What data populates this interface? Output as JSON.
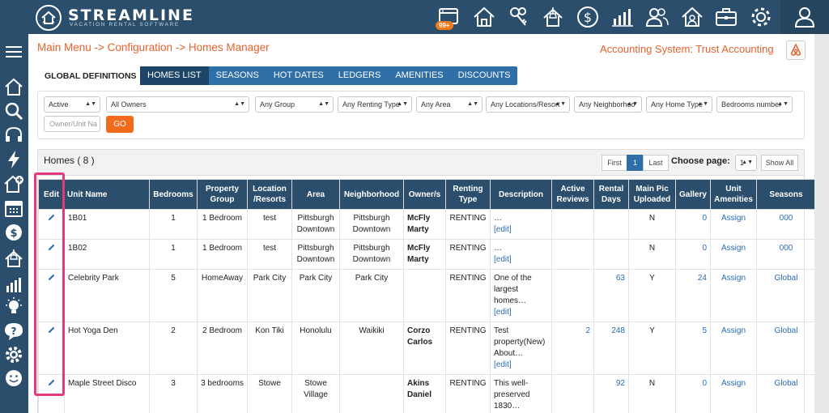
{
  "brand": {
    "name": "STREAMLINE",
    "tagline": "VACATION RENTAL SOFTWARE"
  },
  "topbar": {
    "icons": [
      "inbox-icon",
      "home-icon",
      "keys-icon",
      "housekeeping-icon",
      "dollar-icon",
      "bar-chart-icon",
      "owners-icon",
      "owner-home-icon",
      "toolbox-icon",
      "gear-icon",
      "user-icon"
    ],
    "notification_count": "99+"
  },
  "sidebar": {
    "icons": [
      "home-icon",
      "search-icon",
      "headset-icon",
      "lightning-icon",
      "add-home-icon",
      "calendar-icon",
      "dollar-icon",
      "housekeeping-icon",
      "bar-chart-icon",
      "lightbulb-icon",
      "help-icon",
      "gear-icon",
      "smiley-icon"
    ]
  },
  "breadcrumb": "Main Menu -> Configuration -> Homes Manager",
  "accounting": "Accounting System: Trust Accounting",
  "defs_label": "GLOBAL DEFINITIONS",
  "tabs": [
    {
      "label": "HOMES LIST",
      "active": true
    },
    {
      "label": "SEASONS"
    },
    {
      "label": "HOT DATES"
    },
    {
      "label": "LEDGERS"
    },
    {
      "label": "AMENITIES"
    },
    {
      "label": "DISCOUNTS"
    }
  ],
  "filters": {
    "selects": [
      "Active",
      "All Owners",
      "Any Group",
      "Any Renting Type",
      "Any Area",
      "Any Locations/Resort",
      "Any Neighborhoo",
      "Any Home Type",
      "Bedrooms number"
    ],
    "owner_unit_placeholder": "Owner/Unit Na",
    "go_label": "GO"
  },
  "homes": {
    "title": "Homes ( 8 )",
    "pager": {
      "first": "First",
      "page": "1",
      "last": "Last",
      "choose_label": "Choose page:",
      "choose_value": "1",
      "show_all": "Show All"
    },
    "columns": [
      "Edit",
      "Unit Name",
      "Bedrooms",
      "Property Group",
      "Location /Resorts",
      "Area",
      "Neighborhood",
      "Owner/s",
      "Renting Type",
      "Description",
      "Active Reviews",
      "Rental Days",
      "Main Pic Uploaded",
      "Gallery",
      "Unit Amenities",
      "Seasons"
    ],
    "rows": [
      {
        "unit": "1B01",
        "bedrooms": "1",
        "group": "1 Bedroom",
        "location": "test",
        "area": "Pittsburgh Downtown",
        "neighborhood": "Pittsburgh Downtown",
        "owner": "McFly Marty",
        "renting": "RENTING",
        "desc": "…",
        "desc_edit": "[edit]",
        "reviews": "",
        "days": "",
        "mainpic": "N",
        "gallery": "0",
        "amenities": "Assign",
        "seasons": "000"
      },
      {
        "unit": "1B02",
        "bedrooms": "1",
        "group": "1 Bedroom",
        "location": "test",
        "area": "Pittsburgh Downtown",
        "neighborhood": "Pittsburgh Downtown",
        "owner": "McFly Marty",
        "renting": "RENTING",
        "desc": "…",
        "desc_edit": "[edit]",
        "reviews": "",
        "days": "",
        "mainpic": "N",
        "gallery": "0",
        "amenities": "Assign",
        "seasons": "000"
      },
      {
        "unit": "Celebrity Park",
        "bedrooms": "5",
        "group": "HomeAway",
        "location": "Park City",
        "area": "Park City",
        "neighborhood": "Park City",
        "owner": "",
        "renting": "RENTING",
        "desc": "One of the largest homes…",
        "desc_edit": "[edit]",
        "reviews": "",
        "days": "63",
        "mainpic": "Y",
        "gallery": "24",
        "amenities": "Assign",
        "seasons": "Global"
      },
      {
        "unit": "Hot Yoga Den",
        "bedrooms": "2",
        "group": "2 Bedroom",
        "location": "Kon Tiki",
        "area": "Honolulu",
        "neighborhood": "Waikiki",
        "owner": "Corzo Carlos",
        "renting": "RENTING",
        "desc": "Test property(New) About…",
        "desc_edit": "[edit]",
        "reviews": "2",
        "days": "248",
        "mainpic": "Y",
        "gallery": "5",
        "amenities": "Assign",
        "seasons": "Global"
      },
      {
        "unit": "Maple Street Disco",
        "bedrooms": "3",
        "group": "3 bedrooms",
        "location": "Stowe",
        "area": "Stowe Village",
        "neighborhood": "",
        "owner": "Akins Daniel",
        "renting": "RENTING",
        "desc": "This well-preserved 1830…",
        "desc_edit": "",
        "reviews": "",
        "days": "92",
        "mainpic": "N",
        "gallery": "0",
        "amenities": "Assign",
        "seasons": "Global"
      }
    ]
  },
  "colors": {
    "navy": "#2a4e6c",
    "accent": "#e8612c",
    "link": "#2a6cb3",
    "highlight": "#e23a7c",
    "go": "#f26b1d"
  }
}
